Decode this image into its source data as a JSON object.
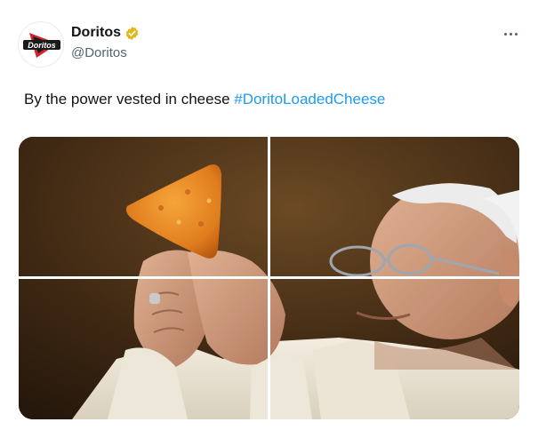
{
  "tweet": {
    "display_name": "Doritos",
    "handle": "@Doritos",
    "verified": true,
    "avatar_logo_text": "Doritos",
    "text": "By the power vested in cheese ",
    "hashtag": "#DoritoLoadedCheese",
    "more_icon": "more-horizontal-icon"
  },
  "colors": {
    "hashtag": "#1d9bf0",
    "verified_badge": "#e2b719",
    "handle": "#536471",
    "brand_red": "#d3242b"
  }
}
